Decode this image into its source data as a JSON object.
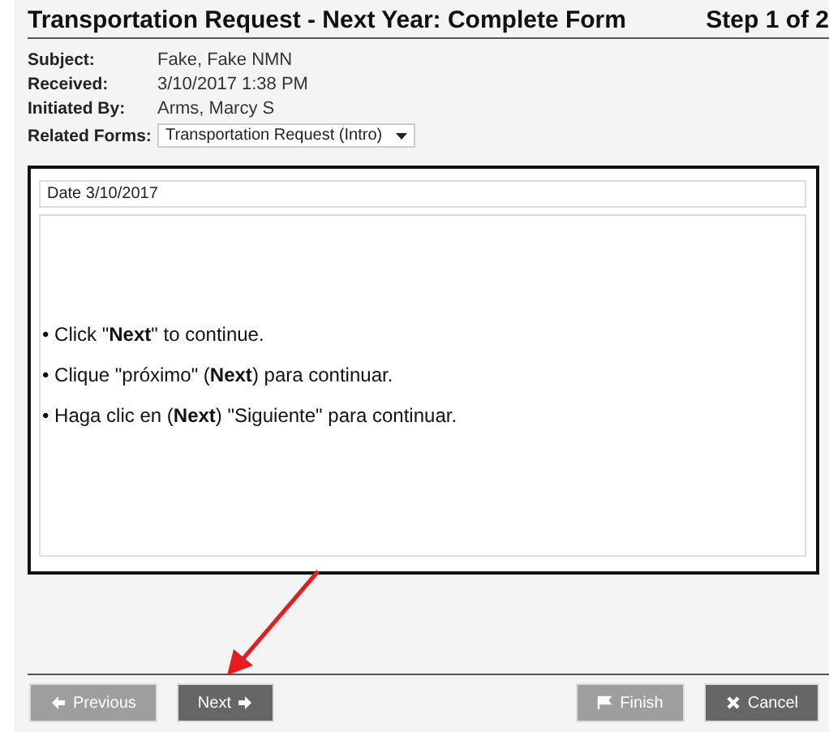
{
  "header": {
    "title": "Transportation Request - Next Year: Complete Form",
    "step": "Step 1 of 2"
  },
  "fields": [
    {
      "label": "Subject:",
      "value": "Fake, Fake NMN",
      "kind": "text"
    },
    {
      "label": "Received:",
      "value": "3/10/2017 1:38 PM",
      "kind": "text"
    },
    {
      "label": "Initiated By:",
      "value": "Arms, Marcy S",
      "kind": "text"
    },
    {
      "label": "Related Forms:",
      "value": "Transportation Request (Intro)",
      "kind": "dropdown"
    }
  ],
  "form": {
    "date_field": "Date 3/10/2017",
    "instructions": [
      "• Click \"**Next**\" to continue.",
      "• Clique \"próximo\" (**Next**) para continuar.",
      "• Haga clic en (**Next**) \"Siguiente\" para continuar."
    ]
  },
  "buttons": [
    {
      "label": "Previous",
      "kind": "previous",
      "disabled": true
    },
    {
      "label": "Next",
      "kind": "next",
      "disabled": false
    },
    {
      "label": "Finish",
      "kind": "finish",
      "disabled": true
    },
    {
      "label": "Cancel",
      "kind": "cancel",
      "disabled": false
    }
  ]
}
